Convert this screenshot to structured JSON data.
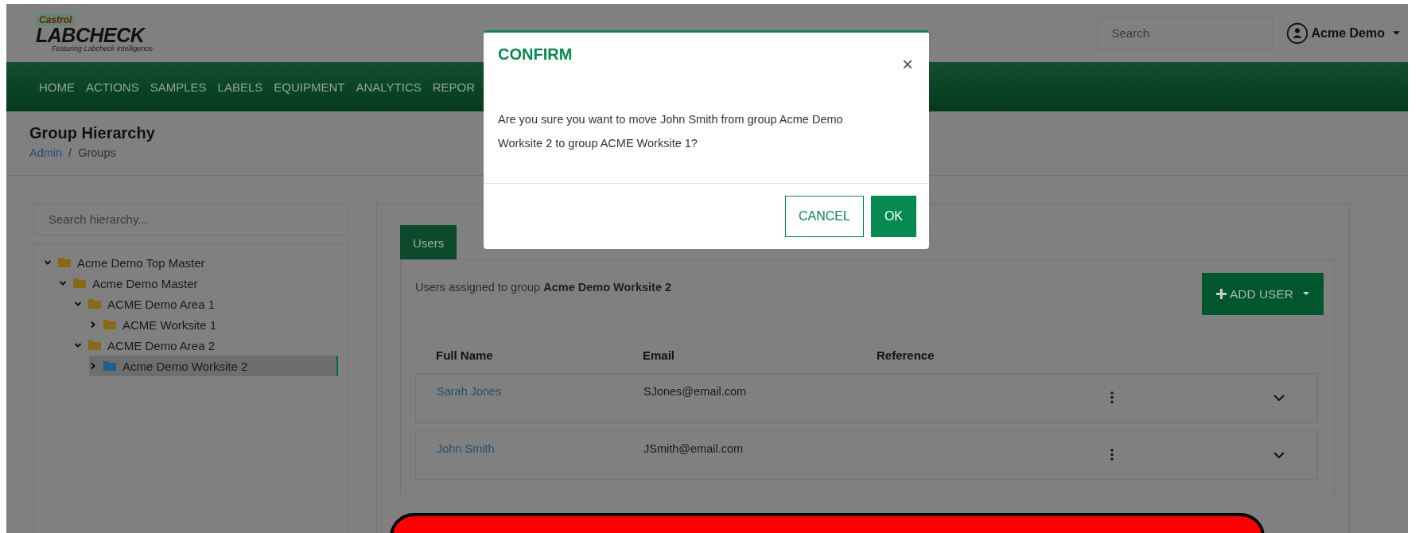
{
  "header": {
    "logo": {
      "brand": "Castrol",
      "product": "LABCHECK",
      "tagline": "Featuring Labcheck Intelligence"
    },
    "search": {
      "placeholder": "Search"
    },
    "user": {
      "name": "Acme Demo"
    }
  },
  "nav": {
    "items": [
      "HOME",
      "ACTIONS",
      "SAMPLES",
      "LABELS",
      "EQUIPMENT",
      "ANALYTICS",
      "REPOR"
    ]
  },
  "page": {
    "title": "Group Hierarchy",
    "breadcrumb": [
      {
        "label": "Admin",
        "kind": "link"
      },
      {
        "label": "Groups",
        "kind": "current"
      }
    ],
    "separator": "/"
  },
  "tree": {
    "search": {
      "placeholder": "Search hierarchy..."
    },
    "items": [
      {
        "label": "Acme Demo Top Master",
        "expanded": true,
        "selected": false,
        "children": [
          {
            "label": "Acme Demo Master",
            "expanded": true,
            "selected": false,
            "children": [
              {
                "label": "ACME Demo Area 1",
                "expanded": true,
                "selected": false,
                "children": [
                  {
                    "label": "ACME Worksite 1",
                    "expanded": false,
                    "selected": false
                  }
                ]
              },
              {
                "label": "ACME Demo Area 2",
                "expanded": true,
                "selected": false,
                "children": [
                  {
                    "label": "Acme Demo Worksite 2",
                    "expanded": false,
                    "selected": true
                  }
                ]
              }
            ]
          }
        ]
      }
    ]
  },
  "panel": {
    "tabs": [
      {
        "label": "Users",
        "selected": true
      }
    ],
    "caption": "Users assigned to group **Acme Demo Worksite 2**",
    "add_button": "ADD USER",
    "table": {
      "columns": [
        "Full Name",
        "Email",
        "Reference"
      ],
      "rows": [
        {
          "name": "Sarah Jones",
          "email": "SJones@email.com"
        },
        {
          "name": "John Smith",
          "email": "JSmith@email.com"
        }
      ]
    }
  },
  "modal": {
    "title": "CONFIRM",
    "close": "×",
    "message": "Are you sure you want to move John Smith from group Acme Demo Worksite 2 to group ACME Worksite 1?",
    "buttons": [
      {
        "label": "CANCEL",
        "kind": "secondary"
      },
      {
        "label": "OK",
        "kind": "primary"
      }
    ]
  }
}
